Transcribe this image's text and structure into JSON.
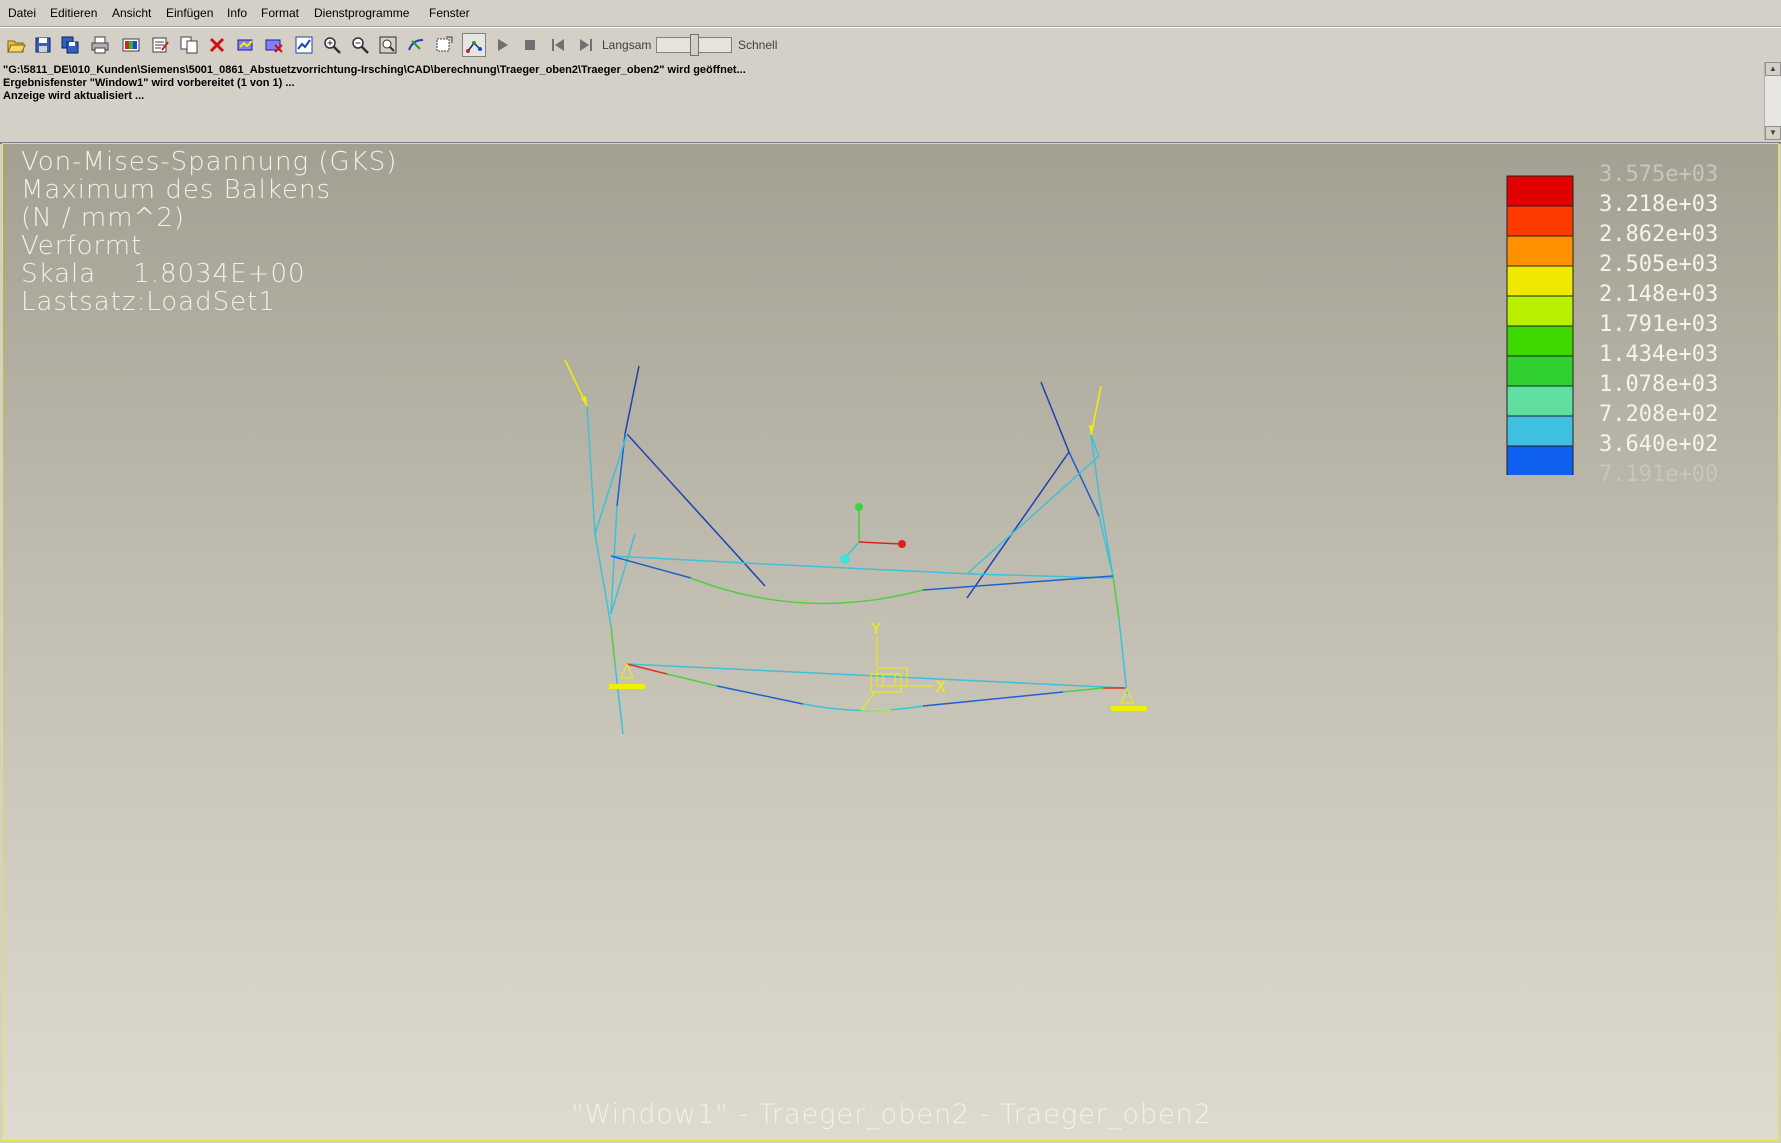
{
  "menu": {
    "items": [
      "Datei",
      "Editieren",
      "Ansicht",
      "Einfügen",
      "Info",
      "Format",
      "Dienstprogramme",
      "Fenster"
    ]
  },
  "toolbar": {
    "buttons": [
      "open-icon",
      "save-icon",
      "save-as-icon",
      "print-icon",
      "palette-icon",
      "edit-definition-icon",
      "copy-icon",
      "delete-icon",
      "show-icon",
      "hide-icon",
      "update-icon",
      "zoom-in-icon",
      "zoom-out-icon",
      "refit-icon",
      "orient-icon",
      "view-icon",
      "animate-frames-icon",
      "play-icon",
      "stop-icon",
      "first-frame-icon",
      "last-frame-icon"
    ],
    "speed_slow": "Langsam",
    "speed_fast": "Schnell"
  },
  "messages": [
    "\"G:\\5811_DE\\010_Kunden\\Siemens\\5001_0861_Abstuetzvorrichtung-Irsching\\CAD\\berechnung\\Traeger_oben2\\Traeger_oben2\" wird geöffnet...",
    "Ergebnisfenster \"Window1\" wird vorbereitet (1 von 1) ...",
    "Anzeige wird aktualisiert ..."
  ],
  "result": {
    "lines": [
      "Von-Mises-Spannung (GKS)",
      "Maximum des Balkens",
      "(N / mm^2)",
      "Verformt",
      "Skala    1.8034E+00",
      "Lastsatz:LoadSet1"
    ],
    "legend": {
      "labels": [
        "3.575e+03",
        "3.218e+03",
        "2.862e+03",
        "2.505e+03",
        "2.148e+03",
        "1.791e+03",
        "1.434e+03",
        "1.078e+03",
        "7.208e+02",
        "3.640e+02",
        "7.191e+00"
      ],
      "colors": [
        "#e00000",
        "#ff3a00",
        "#ff9000",
        "#f0e800",
        "#b8f000",
        "#3cd800",
        "#30d030",
        "#60e0a0",
        "#40c0e0",
        "#1060f0",
        "#2020b0"
      ]
    },
    "footer": "\"Window1\"  -  Traeger_oben2  -  Traeger_oben2",
    "axis_labels": {
      "x": "X",
      "y": "Y"
    }
  }
}
